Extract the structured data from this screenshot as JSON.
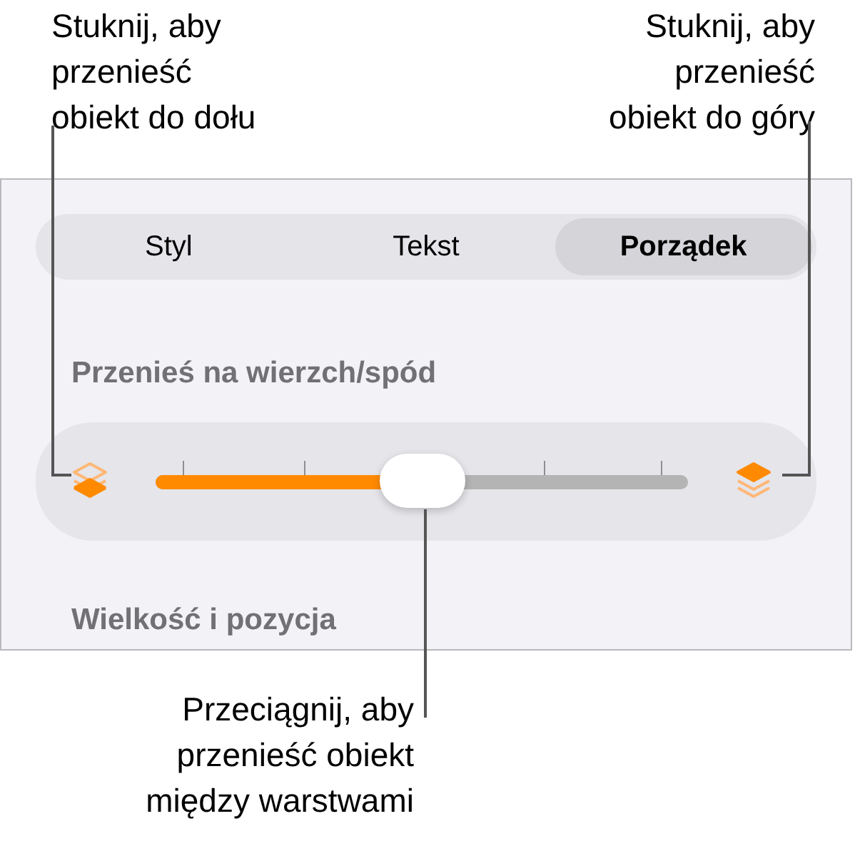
{
  "callouts": {
    "top_left": [
      "Stuknij, aby",
      "przenieść",
      "obiekt do dołu"
    ],
    "top_right": [
      "Stuknij, aby",
      "przenieść",
      "obiekt do góry"
    ],
    "bottom": [
      "Przeciągnij, aby",
      "przenieść obiekt",
      "między warstwami"
    ]
  },
  "tabs": [
    {
      "label": "Styl",
      "selected": false
    },
    {
      "label": "Tekst",
      "selected": false
    },
    {
      "label": "Porządek",
      "selected": true
    }
  ],
  "arrange": {
    "title": "Przenieś na wierzch/spód",
    "slider": {
      "level": 0.5
    }
  },
  "next_section": {
    "title": "Wielkość i pozycja"
  }
}
